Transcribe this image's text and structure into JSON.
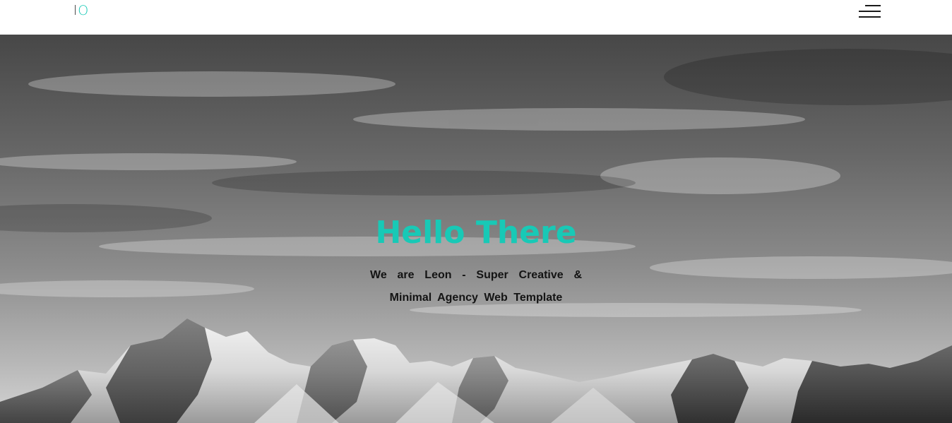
{
  "header": {
    "logo_part1": "l",
    "logo_part2": "O",
    "menu_icon": "hamburger-menu-icon"
  },
  "hero": {
    "background_icon": "mountain-landscape-image",
    "title": "Hello There",
    "subtitle": "We are Leon - Super Creative & Minimal Agency Web Template"
  },
  "colors": {
    "accent": "#18c9b6",
    "header_bg": "#ffffff",
    "text_dark": "#141414"
  }
}
